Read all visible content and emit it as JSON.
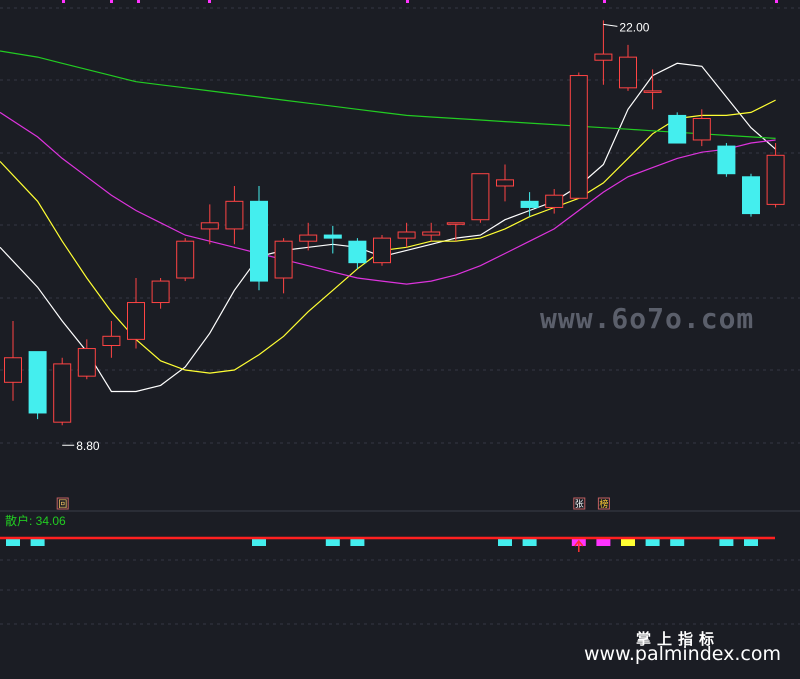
{
  "chart_data": {
    "type": "candlestick",
    "price_range": [
      6.2,
      22.5
    ],
    "high_label": "22.00",
    "low_label": "8.80",
    "candles": [
      {
        "o": 10.2,
        "c": 11.0,
        "h": 12.2,
        "l": 9.6
      },
      {
        "o": 11.2,
        "c": 9.2,
        "h": 11.2,
        "l": 9.0
      },
      {
        "o": 8.9,
        "c": 10.8,
        "h": 11.0,
        "l": 8.8
      },
      {
        "o": 10.4,
        "c": 11.3,
        "h": 11.6,
        "l": 10.3
      },
      {
        "o": 11.4,
        "c": 11.7,
        "h": 12.2,
        "l": 11.0
      },
      {
        "o": 11.6,
        "c": 12.8,
        "h": 13.6,
        "l": 11.3
      },
      {
        "o": 12.8,
        "c": 13.5,
        "h": 13.6,
        "l": 12.6
      },
      {
        "o": 13.6,
        "c": 14.8,
        "h": 14.9,
        "l": 13.5
      },
      {
        "o": 15.2,
        "c": 15.4,
        "h": 16.0,
        "l": 14.7
      },
      {
        "o": 15.2,
        "c": 16.1,
        "h": 16.6,
        "l": 14.7
      },
      {
        "o": 16.1,
        "c": 13.5,
        "h": 16.6,
        "l": 13.2
      },
      {
        "o": 13.6,
        "c": 14.8,
        "h": 14.9,
        "l": 13.1
      },
      {
        "o": 14.8,
        "c": 15.0,
        "h": 15.4,
        "l": 14.5
      },
      {
        "o": 15.0,
        "c": 14.9,
        "h": 15.3,
        "l": 14.4
      },
      {
        "o": 14.8,
        "c": 14.1,
        "h": 14.9,
        "l": 13.9
      },
      {
        "o": 14.1,
        "c": 14.9,
        "h": 15.0,
        "l": 14.0
      },
      {
        "o": 14.9,
        "c": 15.1,
        "h": 15.4,
        "l": 14.6
      },
      {
        "o": 15.0,
        "c": 15.1,
        "h": 15.4,
        "l": 14.8
      },
      {
        "o": 15.4,
        "c": 15.4,
        "h": 15.4,
        "l": 14.8
      },
      {
        "o": 15.5,
        "c": 17.0,
        "h": 17.0,
        "l": 15.4
      },
      {
        "o": 16.6,
        "c": 16.8,
        "h": 17.3,
        "l": 16.1
      },
      {
        "o": 16.1,
        "c": 15.9,
        "h": 16.4,
        "l": 15.6
      },
      {
        "o": 15.9,
        "c": 16.3,
        "h": 16.5,
        "l": 15.7
      },
      {
        "o": 16.2,
        "c": 20.2,
        "h": 20.3,
        "l": 16.2
      },
      {
        "o": 20.7,
        "c": 20.9,
        "h": 22.0,
        "l": 19.9
      },
      {
        "o": 19.8,
        "c": 20.8,
        "h": 21.2,
        "l": 19.7
      },
      {
        "o": 19.7,
        "c": 19.7,
        "h": 20.4,
        "l": 19.1
      },
      {
        "o": 18.9,
        "c": 18.0,
        "h": 19.0,
        "l": 18.0
      },
      {
        "o": 18.1,
        "c": 18.8,
        "h": 19.1,
        "l": 17.9
      },
      {
        "o": 17.9,
        "c": 17.0,
        "h": 18.0,
        "l": 16.9
      },
      {
        "o": 16.9,
        "c": 15.7,
        "h": 17.0,
        "l": 15.6
      },
      {
        "o": 16.0,
        "c": 17.6,
        "h": 18.0,
        "l": 15.9
      }
    ],
    "ma_lines": [
      {
        "color": "#ffffff",
        "values": [
          14.6,
          13.3,
          12.2,
          11.2,
          9.9,
          9.9,
          10.1,
          10.7,
          11.8,
          13.2,
          14.3,
          14.5,
          14.6,
          14.7,
          14.6,
          14.3,
          14.5,
          14.7,
          14.9,
          15.0,
          15.5,
          15.8,
          16.1,
          16.6,
          17.3,
          19.1,
          20.2,
          20.6,
          20.5,
          19.5,
          18.5,
          17.8
        ]
      },
      {
        "color": "#ffff33",
        "values": [
          17.4,
          16.1,
          14.8,
          13.6,
          12.5,
          11.6,
          10.9,
          10.6,
          10.5,
          10.6,
          11.1,
          11.7,
          12.5,
          13.2,
          13.9,
          14.5,
          14.6,
          14.8,
          14.8,
          14.9,
          15.2,
          15.6,
          15.9,
          16.2,
          16.7,
          17.5,
          18.3,
          18.8,
          18.9,
          18.9,
          19.0,
          19.4
        ]
      },
      {
        "color": "#dd33dd",
        "values": [
          19.0,
          18.2,
          17.5,
          16.9,
          16.3,
          15.8,
          15.4,
          15.0,
          14.8,
          14.6,
          14.4,
          14.2,
          14.0,
          13.8,
          13.6,
          13.5,
          13.4,
          13.5,
          13.7,
          14.0,
          14.4,
          14.8,
          15.2,
          15.8,
          16.4,
          16.9,
          17.2,
          17.5,
          17.7,
          17.8,
          18.0,
          18.1
        ]
      },
      {
        "color": "#22cc22",
        "values": [
          21.0,
          20.8,
          20.6,
          20.4,
          20.2,
          20.0,
          19.9,
          19.8,
          19.7,
          19.6,
          19.5,
          19.4,
          19.3,
          19.2,
          19.1,
          19.0,
          18.9,
          18.85,
          18.8,
          18.75,
          18.7,
          18.65,
          18.6,
          18.55,
          18.5,
          18.45,
          18.4,
          18.35,
          18.3,
          18.25,
          18.2,
          18.15
        ]
      }
    ],
    "indicator": {
      "label": "散户: 34.06",
      "line_color": "#ff2020",
      "bars": [
        {
          "i": 0,
          "color": "#44eeee"
        },
        {
          "i": 1,
          "color": "#44eeee"
        },
        {
          "i": 10,
          "color": "#44eeee"
        },
        {
          "i": 13,
          "color": "#44eeee"
        },
        {
          "i": 14,
          "color": "#44eeee"
        },
        {
          "i": 20,
          "color": "#44eeee"
        },
        {
          "i": 21,
          "color": "#44eeee"
        },
        {
          "i": 23,
          "color": "#ff33ff"
        },
        {
          "i": 24,
          "color": "#ff33ff"
        },
        {
          "i": 25,
          "color": "#ffff33"
        },
        {
          "i": 26,
          "color": "#44eeee"
        },
        {
          "i": 27,
          "color": "#44eeee"
        },
        {
          "i": 29,
          "color": "#44eeee"
        },
        {
          "i": 30,
          "color": "#44eeee"
        }
      ]
    },
    "markers": [
      {
        "i": 2,
        "text": "回",
        "color": "#ffcc66"
      },
      {
        "i": 23,
        "text": "张",
        "color": "#ffffff"
      },
      {
        "i": 24,
        "text": "榜",
        "color": "#ffcc33"
      }
    ],
    "colors": {
      "up": "#ff4444",
      "down": "#44eeee",
      "background": "#1b1d24",
      "grid": "#353845",
      "top_marker": "#ff33ff"
    }
  },
  "watermarks": {
    "site_code": "www.6o7o.com",
    "chinese": "掌上指标",
    "url": "www.palmindex.com"
  }
}
